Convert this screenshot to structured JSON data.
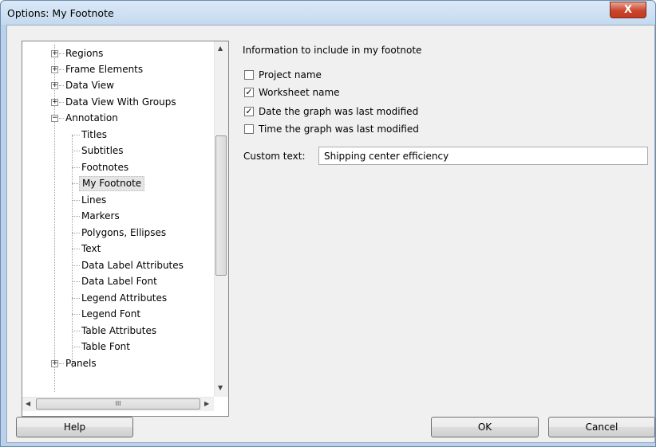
{
  "window": {
    "title": "Options: My Footnote",
    "close_label": "X"
  },
  "tree": {
    "top_nodes": [
      {
        "label": "Regions",
        "expander": "+"
      },
      {
        "label": "Frame Elements",
        "expander": "+"
      },
      {
        "label": "Data View",
        "expander": "+"
      },
      {
        "label": "Data View With Groups",
        "expander": "+"
      },
      {
        "label": "Annotation",
        "expander": "−"
      }
    ],
    "children": [
      "Titles",
      "Subtitles",
      "Footnotes",
      "My Footnote",
      "Lines",
      "Markers",
      "Polygons, Ellipses",
      "Text",
      "Data Label Attributes",
      "Data Label Font",
      "Legend Attributes",
      "Legend Font",
      "Table Attributes",
      "Table Font"
    ],
    "selected": "My Footnote",
    "last_node": {
      "label": "Panels",
      "expander": "+"
    },
    "scroll_grip": "III"
  },
  "panel": {
    "heading": "Information to include in my footnote",
    "checkboxes": [
      {
        "label": "Project name",
        "checked": false
      },
      {
        "label": "Worksheet name",
        "checked": true
      },
      {
        "label": "Date the graph was last modified",
        "checked": true
      },
      {
        "label": "Time the graph was last modified",
        "checked": false
      }
    ],
    "custom_text_label": "Custom text:",
    "custom_text_value": "Shipping center efficiency"
  },
  "buttons": {
    "help": "Help",
    "ok": "OK",
    "cancel": "Cancel"
  }
}
